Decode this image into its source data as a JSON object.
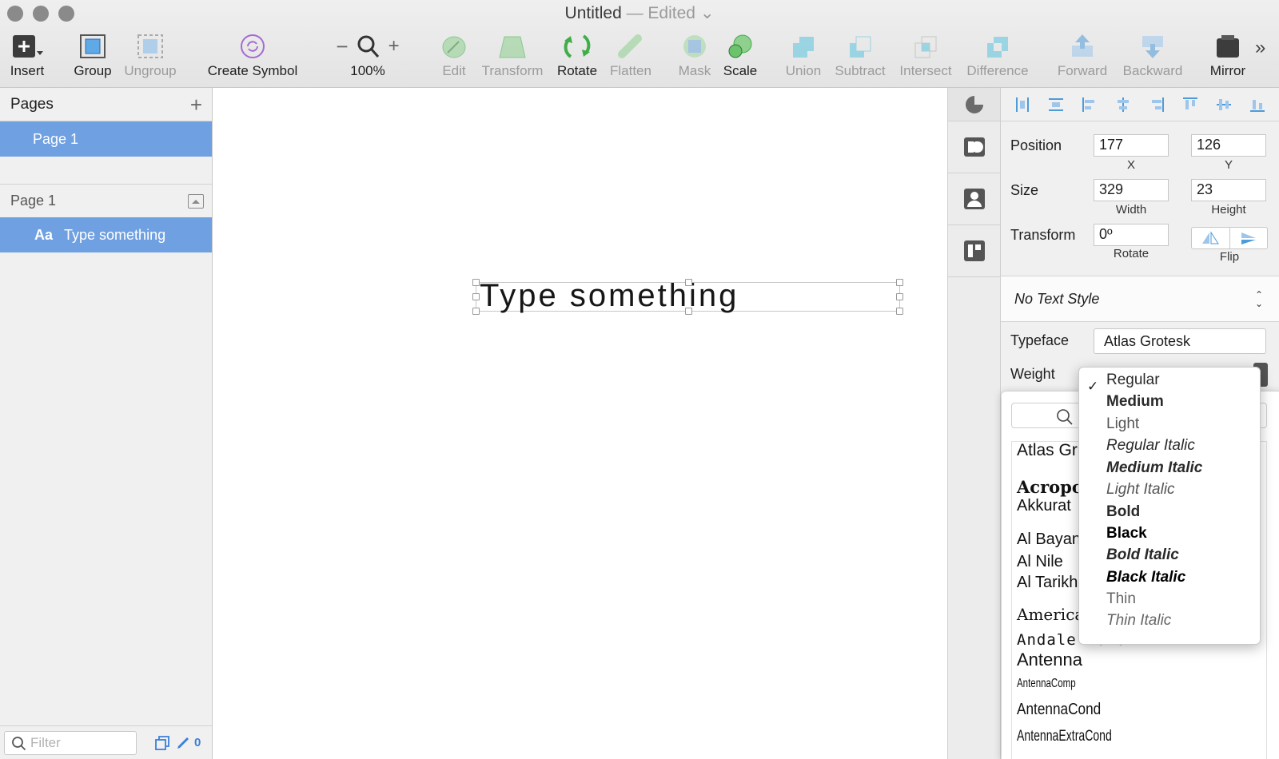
{
  "window": {
    "title": "Untitled",
    "edited": "— Edited"
  },
  "toolbar": {
    "insert": "Insert",
    "group": "Group",
    "ungroup": "Ungroup",
    "create_symbol": "Create Symbol",
    "zoom": "100%",
    "edit": "Edit",
    "transform": "Transform",
    "rotate": "Rotate",
    "flatten": "Flatten",
    "mask": "Mask",
    "scale": "Scale",
    "union": "Union",
    "subtract": "Subtract",
    "intersect": "Intersect",
    "difference": "Difference",
    "forward": "Forward",
    "backward": "Backward",
    "mirror": "Mirror"
  },
  "sidebar": {
    "pages_title": "Pages",
    "pages": [
      "Page 1"
    ],
    "layers_page": "Page 1",
    "layers": [
      {
        "icon": "Aa",
        "name": "Type something"
      }
    ],
    "filter_placeholder": "Filter",
    "edited_count": "0"
  },
  "canvas": {
    "text": "Type something"
  },
  "inspector": {
    "position_label": "Position",
    "x": "177",
    "y": "126",
    "x_cap": "X",
    "y_cap": "Y",
    "size_label": "Size",
    "width": "329",
    "height": "23",
    "width_cap": "Width",
    "height_cap": "Height",
    "transform_label": "Transform",
    "rotate": "0º",
    "rotate_cap": "Rotate",
    "flip_cap": "Flip",
    "text_style": "No Text Style",
    "typeface_label": "Typeface",
    "typeface": "Atlas Grotesk",
    "weight_label": "Weight"
  },
  "font_list": [
    "Atlas Gr",
    "Acropo",
    "Akkurat",
    "Al Bayan",
    "Al Nile",
    "Al Tarikh",
    "America",
    "Andale Mono",
    "Antenna",
    "AntennaComp",
    "AntennaCond",
    "AntennaExtraCond"
  ],
  "weight_menu": {
    "selected": "Regular",
    "options": [
      "Regular",
      "Medium",
      "Light",
      "Regular Italic",
      "Medium Italic",
      "Light Italic",
      "Bold",
      "Black",
      "Bold Italic",
      "Black Italic",
      "Thin",
      "Thin Italic"
    ]
  },
  "colors": {
    "selection": "#6fa0e2",
    "accent_green": "#3fae49",
    "accent_purple": "#a46ad1",
    "boolean_cyan": "#5cc3de"
  }
}
